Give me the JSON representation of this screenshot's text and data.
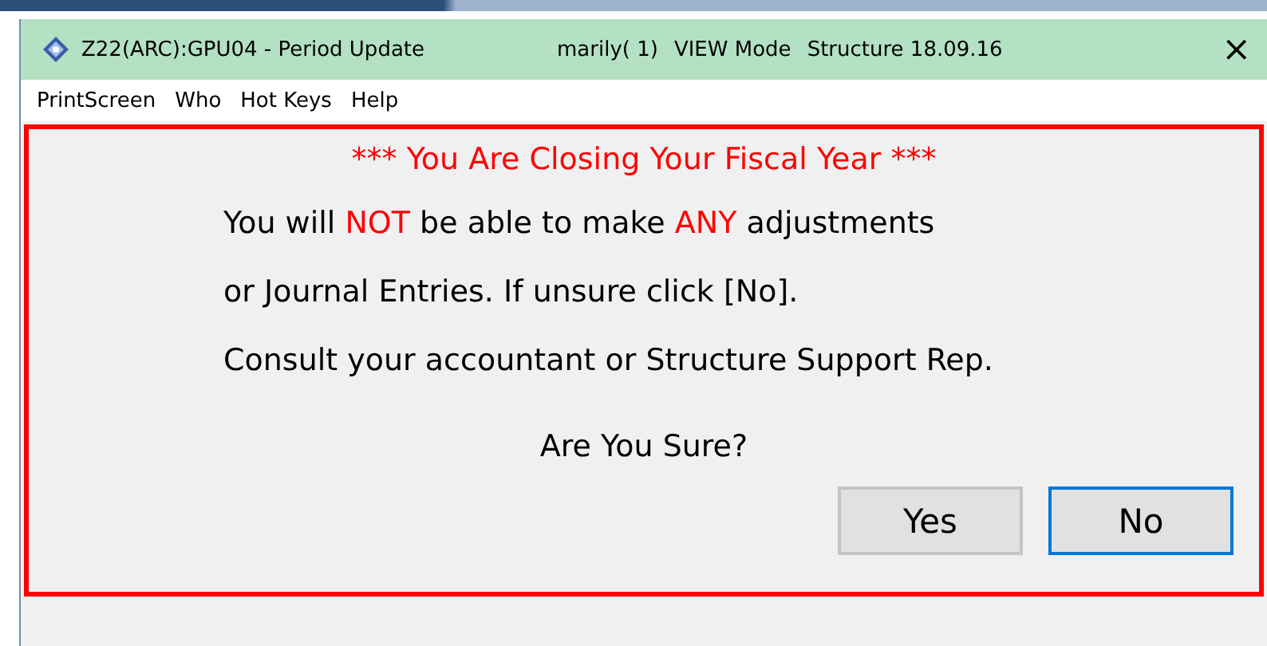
{
  "window": {
    "title": "Z22(ARC):GPU04 - Period Update",
    "user": "marily( 1)",
    "mode": "VIEW  Mode",
    "version": "Structure 18.09.16",
    "close": "×"
  },
  "menu": [
    "PrintScreen",
    "Who",
    "Hot Keys",
    "Help"
  ],
  "dialog": {
    "heading": "*** You Are Closing Your Fiscal Year ***",
    "lines": [
      [
        {
          "text": "You will ",
          "alert": false
        },
        {
          "text": "NOT",
          "alert": true
        },
        {
          "text": " be able to make ",
          "alert": false
        },
        {
          "text": "ANY",
          "alert": true
        },
        {
          "text": " adjustments",
          "alert": false
        }
      ],
      [
        {
          "text": "or Journal Entries.  If unsure click [No].",
          "alert": false
        }
      ],
      [
        {
          "text": "Consult your accountant or Structure Support Rep.",
          "alert": false
        }
      ]
    ],
    "question": "Are You Sure?",
    "buttons": [
      {
        "label": "Yes",
        "focused": false
      },
      {
        "label": "No",
        "focused": true
      }
    ]
  }
}
